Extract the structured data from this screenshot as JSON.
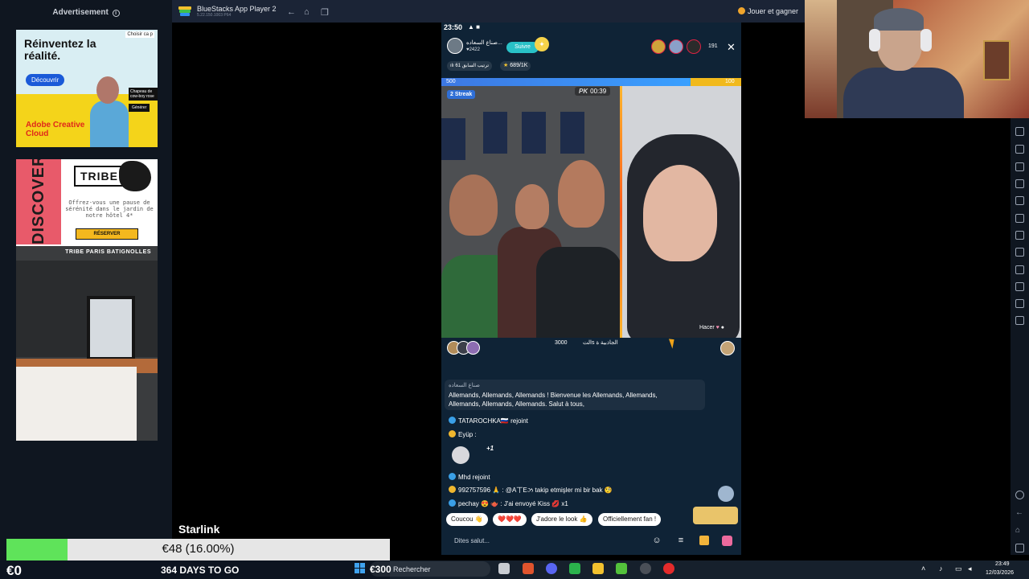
{
  "ad_sidebar": {
    "header": "Advertisement",
    "adobe_ad": {
      "headline": "Réinventez la réalité.",
      "cta": "Découvrir",
      "choose_label": "Choisir ca p",
      "tag_1": "Chapeau de cow-boy rose",
      "tag_2": "Générer",
      "brand": "Adobe Creative Cloud"
    },
    "tribe_ad": {
      "side_text": "DISCOVER",
      "logo": "TRIBE",
      "copy": "Offrez-vous une pause de sérénité dans le jardin de notre hôtel 4*",
      "cta": "RÉSERVER",
      "caption": "TRIBE PARIS BATIGNOLLES"
    }
  },
  "bluestacks": {
    "title": "BlueStacks App Player 2",
    "version": "5.22.150.1003 P64",
    "reward_label": "Jouer et gagner"
  },
  "phone": {
    "status_time": "23:50",
    "host": {
      "name": "صناع السعاده...",
      "likes": "2422"
    },
    "follow_label": "Suivre",
    "viewer_count": "191",
    "rank_label": "61 ترتيب السابق",
    "score_label": "689/1K",
    "pk": {
      "left_score": "500",
      "right_score": "100",
      "left_share": 0.83,
      "timer_tag": "PK",
      "timer": "00:39",
      "streak": "2 Streak",
      "center_label_left": "الت",
      "center_label": "3000s الجاذبية ة",
      "opponent_label": "Hacer"
    },
    "chat": {
      "welcome_user": "صناع السعاده",
      "welcome_msg": "Allemands, Allemands, Allemands ! Bienvenue les Allemands, Allemands, Allemands, Allemands, Allemands. Salut à tous,",
      "line_1": "TATAROCHKA🇷🇺 rejoint",
      "line_2": "Eyüp :",
      "plus_count": "+1",
      "line_3": "Mhd rejoint",
      "line_4": "992757596 🙏 : @A丅Eઝ takip etmişler mi bir bak 🧐",
      "line_5": "pechay 😍 🫖 : J'ai envoyé Kiss 💋 x1"
    },
    "quick_replies": [
      "Coucou 👋",
      "❤️❤️❤️",
      "J'adore le look 👍",
      "Officiellement fan !"
    ],
    "comment_placeholder": "Dites salut..."
  },
  "overlay": {
    "starlink_label": "Starlink",
    "progress_text": "€48 (16.00%)",
    "progress_fraction": 0.16,
    "money_left": "€0",
    "days_left": "364 DAYS TO GO",
    "money_right": "€300"
  },
  "taskbar": {
    "search_label": "Rechercher",
    "time": "23:49",
    "date": "12/03/2026"
  }
}
